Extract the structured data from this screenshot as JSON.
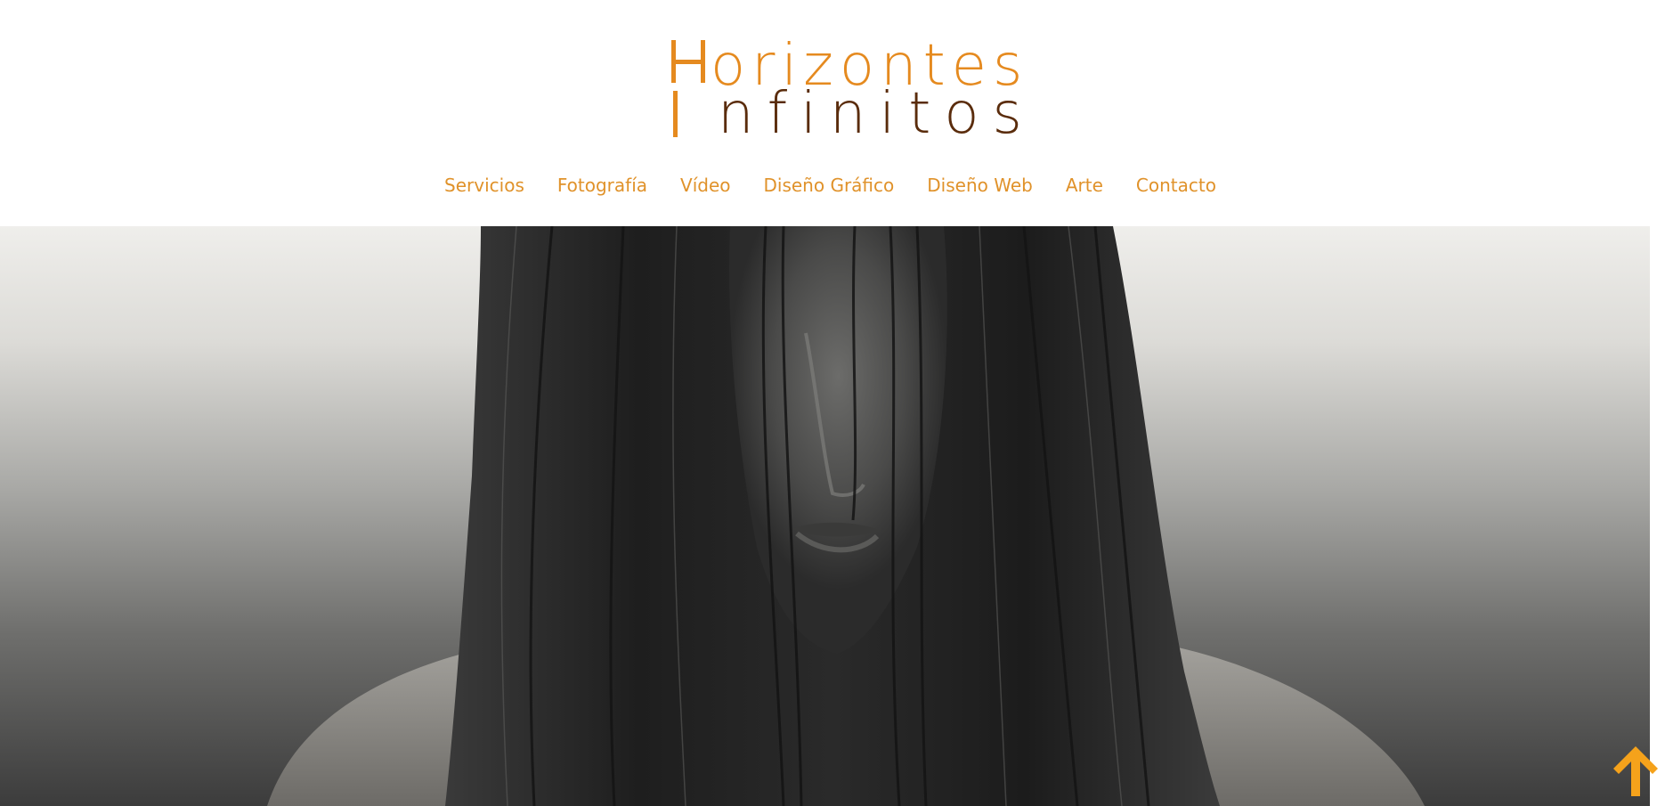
{
  "brand": {
    "line1": "Horizontes",
    "line1_rest": "orizontes",
    "line2": "nfinitos",
    "primary_color": "#e58a1f",
    "secondary_color": "#5a2c0c"
  },
  "nav": {
    "items": [
      {
        "label": "Servicios"
      },
      {
        "label": "Fotografía"
      },
      {
        "label": "Vídeo"
      },
      {
        "label": "Diseño Gráfico"
      },
      {
        "label": "Diseño Web"
      },
      {
        "label": "Arte"
      },
      {
        "label": "Contacto"
      }
    ],
    "color": "#e0922a"
  },
  "hero": {
    "image_subject": "black-and-white portrait of a woman with long hair covering her face",
    "style": "monochrome"
  },
  "back_to_top": {
    "icon": "arrow-up-icon",
    "color": "#f5a21b"
  }
}
